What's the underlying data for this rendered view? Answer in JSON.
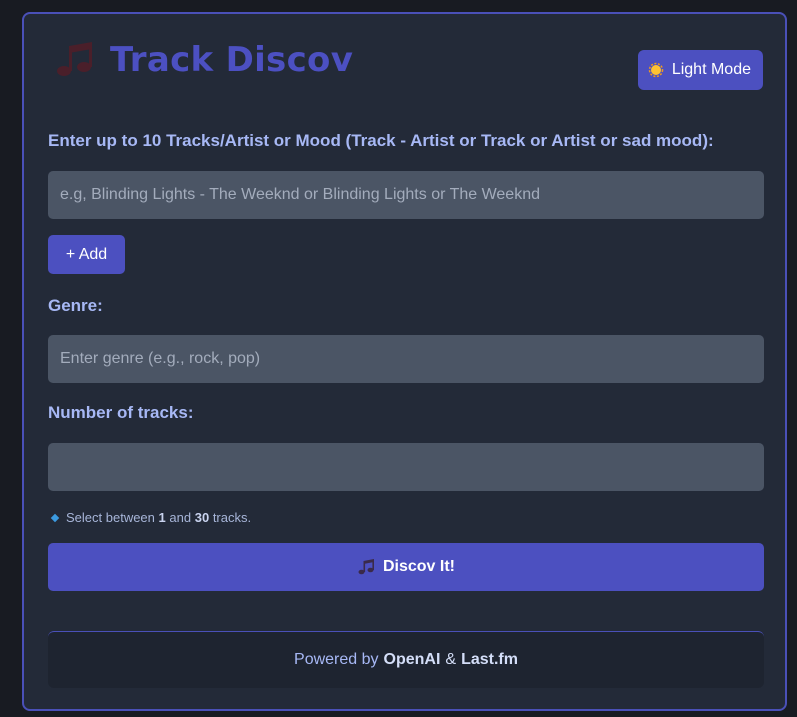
{
  "app": {
    "title": "Track Discov",
    "logo_icon": "music-note-icon"
  },
  "theme_toggle": {
    "icon": "sun-icon",
    "label": "Light Mode"
  },
  "tracks": {
    "label": "Enter up to 10 Tracks/Artist or Mood (Track - Artist or Track or Artist or sad mood):",
    "placeholder": "e.g, Blinding Lights - The Weeknd or Blinding Lights or The Weeknd",
    "value": "",
    "add_label": "+ Add"
  },
  "genre": {
    "label": "Genre:",
    "placeholder": "Enter genre (e.g., rock, pop)",
    "value": ""
  },
  "count": {
    "label": "Number of tracks:",
    "value": "",
    "hint_pre": "Select between",
    "hint_min": "1",
    "hint_and": "and",
    "hint_max": "30",
    "hint_post": "tracks."
  },
  "submit": {
    "icon": "music-notes-icon",
    "label": "Discov It!"
  },
  "footer": {
    "pre": "Powered by",
    "brand1": "OpenAI",
    "sep": "&",
    "brand2": "Last.fm"
  },
  "colors": {
    "accent": "#4c50c0",
    "card_bg": "#232a38",
    "page_bg": "#181b22",
    "label": "#a7b8f5",
    "field_bg": "#4b5565"
  }
}
